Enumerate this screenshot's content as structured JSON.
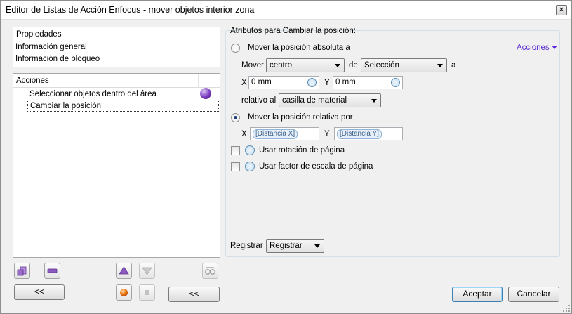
{
  "window": {
    "title": "Editor de Listas de Acción Enfocus - mover objetos interior zona",
    "close_label": "×"
  },
  "properties": {
    "header": "Propiedades",
    "items": [
      "Información general",
      "Información de bloqueo"
    ]
  },
  "actions": {
    "header": "Acciones",
    "items": [
      {
        "label": "Seleccionar objetos dentro del área"
      },
      {
        "label": "Cambiar la posición"
      }
    ]
  },
  "left_buttons": {
    "collapse_label": "<<"
  },
  "main_buttons": {
    "collapse_label": "<<",
    "accept": "Aceptar",
    "cancel": "Cancelar"
  },
  "settings": {
    "group_title": "Atributos para Cambiar la posición:",
    "acciones_link": "Acciones",
    "absolute": {
      "label": "Mover la posición absoluta a",
      "mover_label": "Mover",
      "mover_value": "centro",
      "de_label": "de",
      "de_value": "Selección",
      "a_label": "a",
      "x_label": "X",
      "x_value": "0 mm",
      "y_label": "Y",
      "y_value": "0 mm",
      "relativo_label": "relativo al",
      "relativo_value": "casilla de material"
    },
    "relative": {
      "label": "Mover la posición relativa por",
      "x_label": "X",
      "x_token": "[Distancia X]",
      "y_label": "Y",
      "y_token": "[Distancia Y]"
    },
    "rotation_label": "Usar rotación de página",
    "scale_label": "Usar factor de escala de página",
    "registrar_label": "Registrar",
    "registrar_value": "Registrar"
  }
}
